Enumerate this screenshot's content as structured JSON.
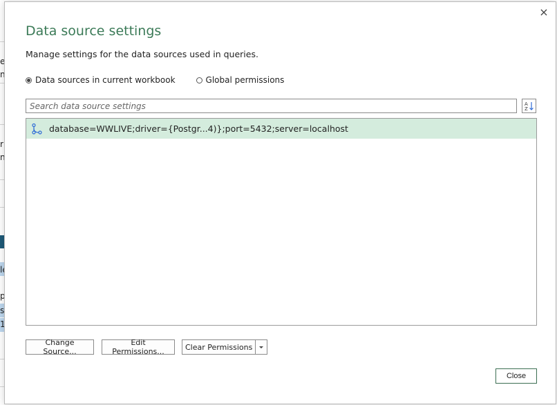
{
  "background": {
    "chars": [
      "e",
      "n",
      "r",
      "n",
      "le",
      "p",
      "s",
      "1("
    ]
  },
  "dialog": {
    "title": "Data source settings",
    "description": "Manage settings for the data sources used in queries.",
    "close_glyph": "×",
    "scope": {
      "options": [
        {
          "label": "Data sources in current workbook",
          "selected": true
        },
        {
          "label": "Global permissions",
          "selected": false
        }
      ]
    },
    "search": {
      "placeholder": "Search data source settings",
      "value": ""
    },
    "sort_icon": "sort-az-icon",
    "sources": [
      {
        "label": "database=WWLIVE;driver={Postgr...4)};port=5432;server=localhost",
        "selected": true,
        "icon": "database-connection-icon"
      }
    ],
    "buttons": {
      "change_source": "Change Source...",
      "edit_permissions": "Edit Permissions...",
      "clear_permissions": "Clear Permissions",
      "close": "Close"
    },
    "colors": {
      "title": "#3b7a57",
      "selected_row": "#d4ecdd",
      "icon_blue": "#2e6bd6"
    }
  }
}
